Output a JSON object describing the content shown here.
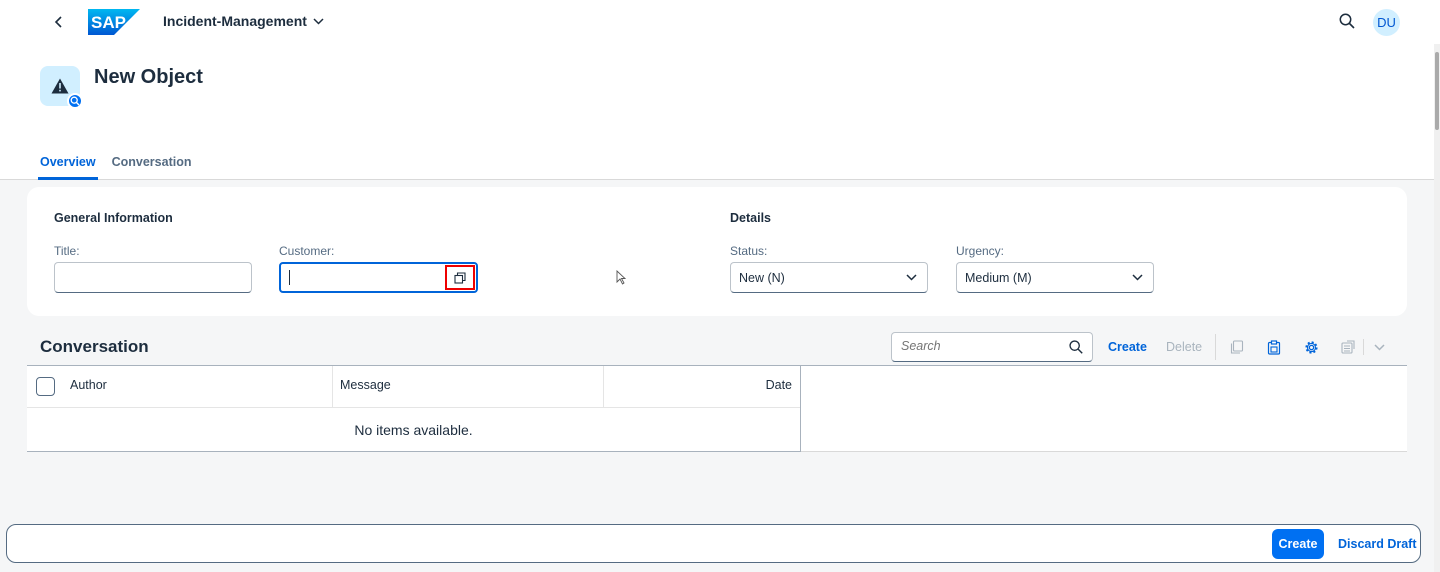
{
  "shell": {
    "app_title": "Incident-Management",
    "logo_text": "SAP",
    "avatar_initials": "DU"
  },
  "object": {
    "title": "New Object",
    "tabs": [
      {
        "label": "Overview",
        "active": true
      },
      {
        "label": "Conversation",
        "active": false
      }
    ]
  },
  "form": {
    "general_title": "General Information",
    "details_title": "Details",
    "title_label": "Title:",
    "title_value": "",
    "customer_label": "Customer:",
    "customer_value": "",
    "status_label": "Status:",
    "status_value": "New (N)",
    "urgency_label": "Urgency:",
    "urgency_value": "Medium (M)"
  },
  "conversation": {
    "title": "Conversation",
    "search_placeholder": "Search",
    "create_label": "Create",
    "delete_label": "Delete",
    "columns": [
      "Author",
      "Message",
      "Date"
    ],
    "empty_text": "No items available."
  },
  "footer": {
    "create_label": "Create",
    "discard_label": "Discard Draft"
  },
  "colors": {
    "brand": "#0070f2",
    "link": "#0064d9",
    "highlight": "#e00000"
  }
}
